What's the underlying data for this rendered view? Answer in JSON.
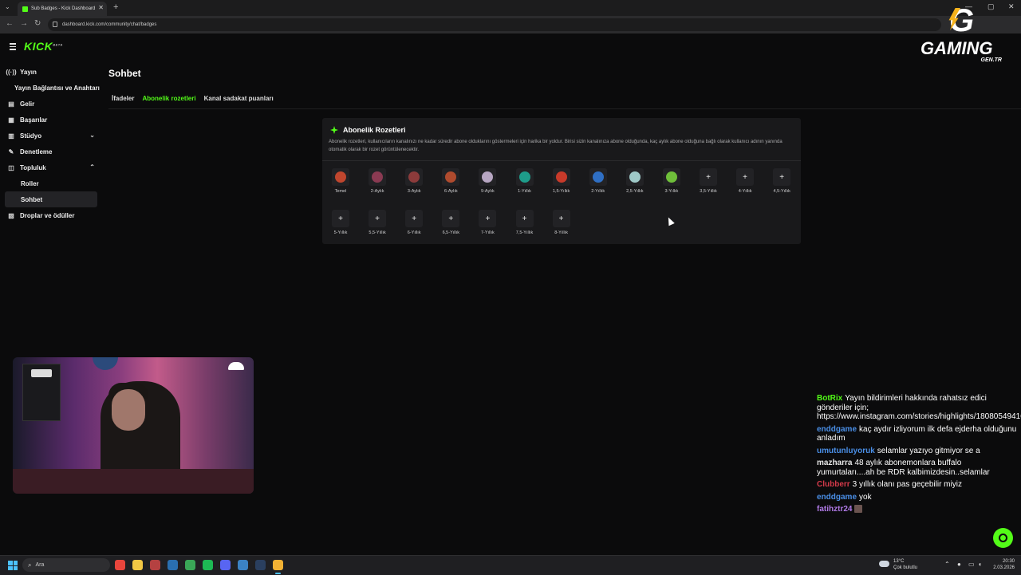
{
  "browser": {
    "tab_title": "Sub Badges - Kick Dashboard",
    "tab_close": "✕",
    "tab_list_arrow": "⌄",
    "new_tab": "+",
    "url": "dashboard.kick.com/community/chat/badges",
    "back": "←",
    "forward": "→",
    "reload": "↻",
    "minimize": "—",
    "maximize": "▢",
    "close": "✕"
  },
  "overlay_logo": {
    "letter": "G",
    "word": "GAMING",
    "sub": "GEN.TR"
  },
  "app": {
    "logo": "KICK",
    "logo_badge": "BETA"
  },
  "sidebar": {
    "items": [
      {
        "label": "Yayın",
        "icon": "((·))"
      },
      {
        "label": "Yayın Bağlantısı ve Anahtarı"
      },
      {
        "label": "Gelir",
        "icon": "▤"
      },
      {
        "label": "Başarılar",
        "icon": "▦"
      },
      {
        "label": "Stüdyo",
        "icon": "▥",
        "chevron": "⌄"
      },
      {
        "label": "Denetleme",
        "icon": "✎"
      },
      {
        "label": "Topluluk",
        "icon": "◫",
        "chevron": "⌃"
      },
      {
        "label": "Roller"
      },
      {
        "label": "Sohbet"
      },
      {
        "label": "Droplar ve ödüller",
        "icon": "▧"
      }
    ]
  },
  "page": {
    "title": "Sohbet",
    "tabs": [
      "İfadeler",
      "Abonelik rozetleri",
      "Kanal sadakat puanları"
    ],
    "active_tab": "Abonelik rozetleri"
  },
  "card": {
    "title": "Abonelik Rozetleri",
    "description": "Abonelik rozetleri, kullanıcıların kanalınızı ne kadar süredir abone olduklarını göstermeleri için harika bir yoldur. Birisi sizin kanalınıza abone olduğunda, kaç aylık abone olduğuna bağlı olarak kullanıcı adının yanında otomatik olarak bir rozet görüntülenecektir.",
    "badges": [
      {
        "label": "Temel",
        "color": "#c0462e"
      },
      {
        "label": "2-Aylık",
        "color": "#8a3a52"
      },
      {
        "label": "3-Aylık",
        "color": "#8c3b3b"
      },
      {
        "label": "6-Aylık",
        "color": "#b04b2e"
      },
      {
        "label": "9-Aylık",
        "color": "#b7a6c2"
      },
      {
        "label": "1-Yıllık",
        "color": "#1e9c8a"
      },
      {
        "label": "1,5-Yıllık",
        "color": "#c83a2a"
      },
      {
        "label": "2-Yıllık",
        "color": "#2f6fc4"
      },
      {
        "label": "2,5-Yıllık",
        "color": "#9ec8c7"
      },
      {
        "label": "3-Yıllık",
        "color": "#6fbf3a"
      },
      {
        "label": "3,5-Yıllık",
        "plus": "+"
      },
      {
        "label": "4-Yıllık",
        "plus": "+"
      },
      {
        "label": "4,5-Yıllık",
        "plus": "+"
      },
      {
        "label": "5-Yıllık",
        "plus": "+"
      },
      {
        "label": "5,5-Yıllık",
        "plus": "+"
      },
      {
        "label": "6-Yıllık",
        "plus": "+"
      },
      {
        "label": "6,5-Yıllık",
        "plus": "+"
      },
      {
        "label": "7-Yıllık",
        "plus": "+"
      },
      {
        "label": "7,5-Yıllık",
        "plus": "+"
      },
      {
        "label": "8-Yıllık",
        "plus": "+"
      }
    ]
  },
  "chat": {
    "messages": [
      {
        "user": "BotRix",
        "color": "#53fc18",
        "text": "Yayın bildirimleri hakkında rahatsız edici gönderiler için; https://www.instagram.com/stories/highlights/18080549416792482/"
      },
      {
        "user": "enddgame",
        "color": "#4a8fe7",
        "text": "kaç aydır izliyorum ilk defa ejderha olduğunu anladım"
      },
      {
        "user": "umutunluyoruk",
        "color": "#4a8fe7",
        "text": "selamlar yazıyo gitmiyor se a"
      },
      {
        "user": "mazharra",
        "color": "#e6e6e6",
        "text": "48 aylık abonemonlara buffalo yumurtaları....ah be RDR kalbimizdesin..selamlar"
      },
      {
        "user": "Clubberr",
        "color": "#d43a4a",
        "text": "3 yıllık olanı pas geçebilir miyiz"
      },
      {
        "user": "enddgame",
        "color": "#4a8fe7",
        "text": "yok"
      },
      {
        "user": "fatihztr24",
        "color": "#b07ae6",
        "text": ""
      }
    ]
  },
  "taskbar": {
    "search_placeholder": "Ara",
    "weather_temp": "13°C",
    "weather_desc": "Çok bulutlu",
    "time": "20:30",
    "date": "2.03.2026",
    "apps": [
      {
        "name": "chrome",
        "color": "#e8453c"
      },
      {
        "name": "files",
        "color": "#f2c744"
      },
      {
        "name": "chrome-alt",
        "color": "#b54141"
      },
      {
        "name": "steam",
        "color": "#2a6fb0"
      },
      {
        "name": "notepad",
        "color": "#3aa657"
      },
      {
        "name": "spotify",
        "color": "#1db954"
      },
      {
        "name": "discord",
        "color": "#5865f2"
      },
      {
        "name": "app-blue",
        "color": "#3b82c4"
      },
      {
        "name": "steam-alt",
        "color": "#2a3f5f"
      },
      {
        "name": "chrome-active",
        "color": "#f2b134"
      }
    ]
  }
}
